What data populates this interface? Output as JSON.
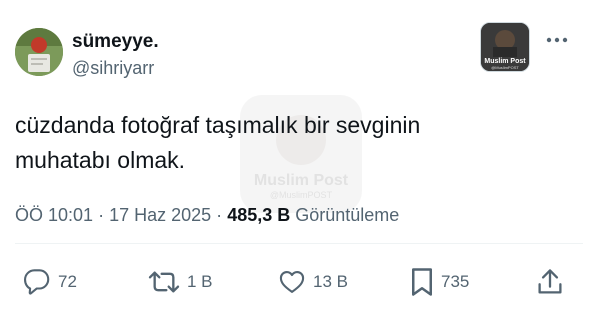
{
  "author": {
    "display_name": "sümeyye.",
    "handle": "@sihriyarr"
  },
  "badge": {
    "name": "Muslim Post",
    "handle": "@MuslimPOST"
  },
  "tweet": {
    "line1": "cüzdanda fotoğraf taşımalık bir sevginin",
    "line2": "muhatabı olmak."
  },
  "watermark": {
    "name": "Muslim Post",
    "handle": "@MuslimPOST"
  },
  "meta": {
    "time": "ÖÖ 10:01",
    "separator": "·",
    "date": "17 Haz 2025",
    "views_count": "485,3 B",
    "views_label": "Görüntüleme"
  },
  "actions": {
    "replies": "72",
    "reposts": "1 B",
    "likes": "13 B",
    "bookmarks": "735"
  },
  "icons": {
    "more": "more-dots-icon",
    "reply": "reply-icon",
    "repost": "repost-icon",
    "like": "heart-icon",
    "bookmark": "bookmark-icon",
    "share": "share-icon"
  }
}
